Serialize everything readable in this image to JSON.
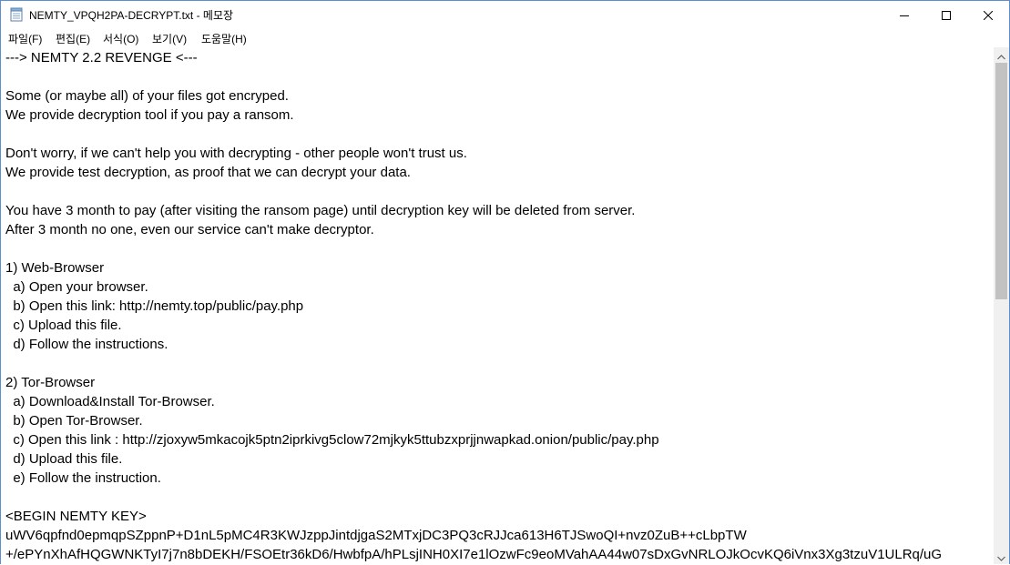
{
  "window": {
    "title": "NEMTY_VPQH2PA-DECRYPT.txt - 메모장"
  },
  "menu": {
    "items": [
      {
        "label": "파일(F)"
      },
      {
        "label": "편집(E)"
      },
      {
        "label": "서식(O)"
      },
      {
        "label": "보기(V)"
      },
      {
        "label": "도움말(H)"
      }
    ]
  },
  "document": {
    "lines": [
      "---> NEMTY 2.2 REVENGE <---",
      "",
      "Some (or maybe all) of your files got encryped.",
      "We provide decryption tool if you pay a ransom.",
      "",
      "Don't worry, if we can't help you with decrypting - other people won't trust us.",
      "We provide test decryption, as proof that we can decrypt your data.",
      "",
      "You have 3 month to pay (after visiting the ransom page) until decryption key will be deleted from server.",
      "After 3 month no one, even our service can't make decryptor.",
      "",
      "1) Web-Browser",
      "  a) Open your browser.",
      "  b) Open this link: http://nemty.top/public/pay.php",
      "  c) Upload this file.",
      "  d) Follow the instructions.",
      "",
      "2) Tor-Browser",
      "  a) Download&Install Tor-Browser.",
      "  b) Open Tor-Browser.",
      "  c) Open this link : http://zjoxyw5mkacojk5ptn2iprkivg5clow72mjkyk5ttubzxprjjnwapkad.onion/public/pay.php",
      "  d) Upload this file.",
      "  e) Follow the instruction.",
      "",
      "<BEGIN NEMTY KEY>",
      "uWV6qpfnd0epmqpSZppnP+D1nL5pMC4R3KWJzppJintdjgaS2MTxjDC3PQ3cRJJca613H6TJSwoQI+nvz0ZuB++cLbpTW",
      "+/ePYnXhAfHQGWNKTyI7j7n8bDEKH/FSOEtr36kD6/HwbfpA/hPLsjINH0XI7e1lOzwFc9eoMVahAA44w07sDxGvNRLOJkOcvKQ6iVnx3Xg3tzuV1ULRq/uG"
    ]
  },
  "scrollbar": {
    "position": 0.0
  }
}
